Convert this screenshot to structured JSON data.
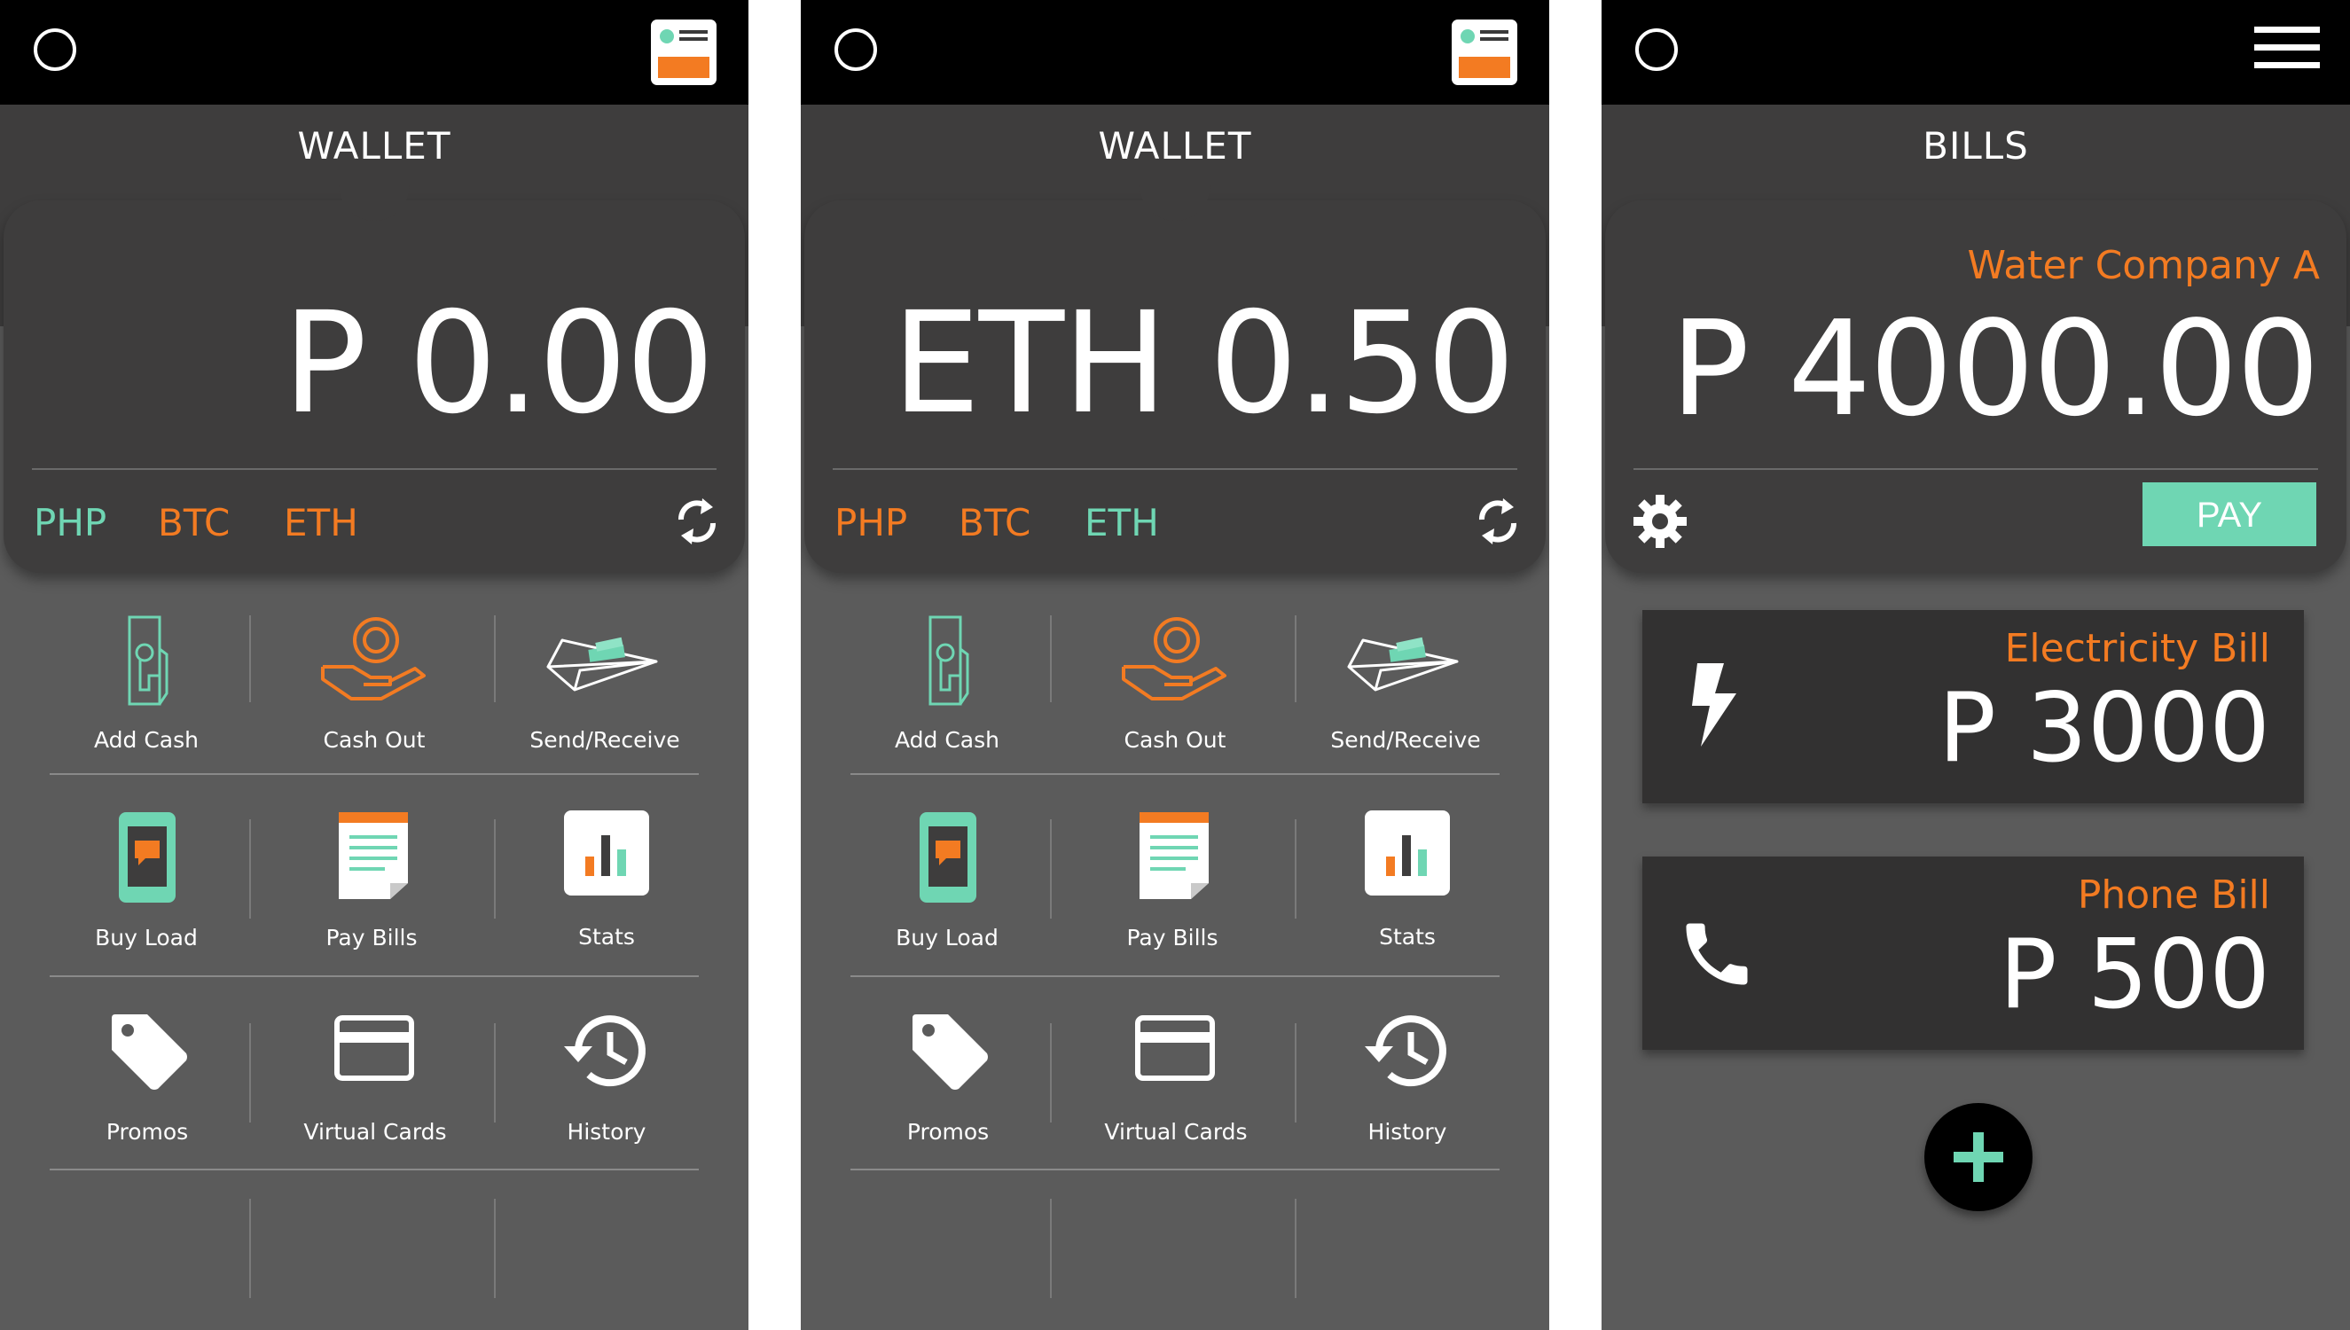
{
  "colors": {
    "accent_green": "#6fd6b3",
    "accent_orange": "#f37b22",
    "card_dark": "#3e3d3d",
    "bg_gray": "#5b5b5b"
  },
  "screens": [
    {
      "title": "WALLET",
      "amount": "P 0.00",
      "currencies": [
        {
          "label": "PHP",
          "active": true
        },
        {
          "label": "BTC",
          "active": false
        },
        {
          "label": "ETH",
          "active": false
        }
      ],
      "actions": [
        {
          "label": "Add Cash",
          "icon": "add-cash-icon"
        },
        {
          "label": "Cash Out",
          "icon": "cash-out-icon"
        },
        {
          "label": "Send/Receive",
          "icon": "send-receive-icon"
        },
        {
          "label": "Buy Load",
          "icon": "phone-load-icon"
        },
        {
          "label": "Pay Bills",
          "icon": "bill-document-icon"
        },
        {
          "label": "Stats",
          "icon": "stats-chart-icon"
        },
        {
          "label": "Promos",
          "icon": "tag-icon"
        },
        {
          "label": "Virtual Cards",
          "icon": "credit-card-icon"
        },
        {
          "label": "History",
          "icon": "history-clock-icon"
        }
      ]
    },
    {
      "title": "WALLET",
      "amount": "ETH 0.50",
      "currencies": [
        {
          "label": "PHP",
          "active": false
        },
        {
          "label": "BTC",
          "active": false
        },
        {
          "label": "ETH",
          "active": true
        }
      ],
      "actions": [
        {
          "label": "Add Cash",
          "icon": "add-cash-icon"
        },
        {
          "label": "Cash Out",
          "icon": "cash-out-icon"
        },
        {
          "label": "Send/Receive",
          "icon": "send-receive-icon"
        },
        {
          "label": "Buy Load",
          "icon": "phone-load-icon"
        },
        {
          "label": "Pay Bills",
          "icon": "bill-document-icon"
        },
        {
          "label": "Stats",
          "icon": "stats-chart-icon"
        },
        {
          "label": "Promos",
          "icon": "tag-icon"
        },
        {
          "label": "Virtual Cards",
          "icon": "credit-card-icon"
        },
        {
          "label": "History",
          "icon": "history-clock-icon"
        }
      ]
    },
    {
      "title": "BILLS",
      "featured_name": "Water Company A",
      "featured_amount": "P 4000.00",
      "pay_label": "PAY",
      "bills": [
        {
          "name": "Electricity Bill",
          "amount": "P 3000",
          "icon": "lightning-icon"
        },
        {
          "name": "Phone Bill",
          "amount": "P 500",
          "icon": "phone-icon"
        }
      ]
    }
  ]
}
